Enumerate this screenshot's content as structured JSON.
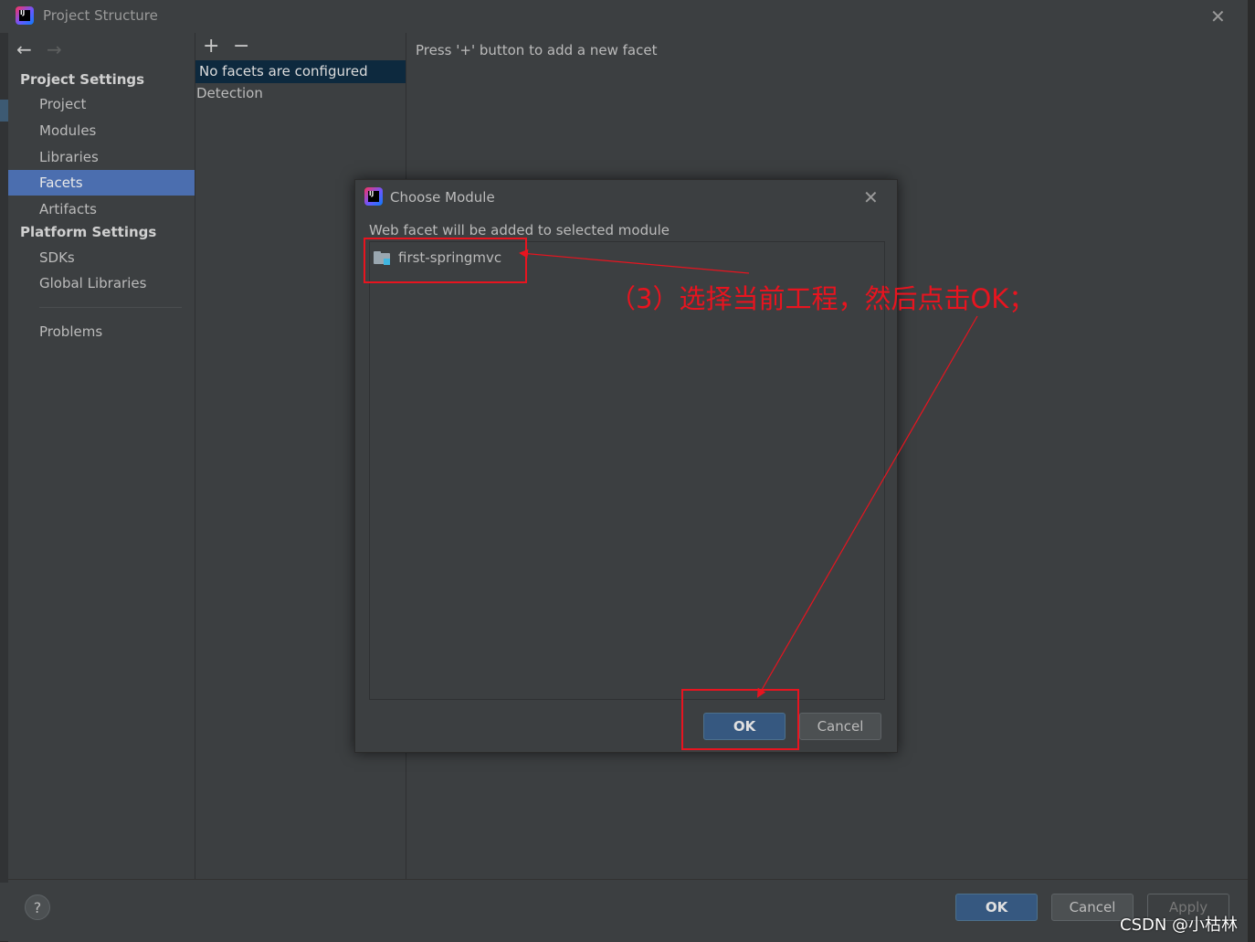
{
  "window": {
    "title": "Project Structure"
  },
  "sidebar": {
    "back": "←",
    "forward": "→",
    "project_settings_label": "Project Settings",
    "platform_settings_label": "Platform Settings",
    "items": [
      {
        "label": "Project"
      },
      {
        "label": "Modules"
      },
      {
        "label": "Libraries"
      },
      {
        "label": "Facets",
        "selected": true
      },
      {
        "label": "Artifacts"
      },
      {
        "label": "SDKs"
      },
      {
        "label": "Global Libraries"
      },
      {
        "label": "Problems"
      }
    ]
  },
  "facets": {
    "add": "+",
    "remove": "−",
    "empty_label": "No facets are configured",
    "detection_label": "Detection",
    "hint": "Press '+' button to add a new facet"
  },
  "dialog": {
    "title": "Choose Module",
    "description": "Web facet will be added to selected module",
    "modules": [
      {
        "name": "first-springmvc"
      }
    ],
    "ok": "OK",
    "cancel": "Cancel"
  },
  "footer": {
    "help": "?",
    "ok": "OK",
    "cancel": "Cancel",
    "apply": "Apply"
  },
  "annotation": {
    "text": "（3）选择当前工程，然后点击OK；",
    "color": "#e8141f"
  },
  "watermark": "CSDN @小枯林",
  "colors": {
    "selection": "#4b6eaf",
    "default_button": "#365880",
    "folder_badge": "#40b6e0"
  }
}
